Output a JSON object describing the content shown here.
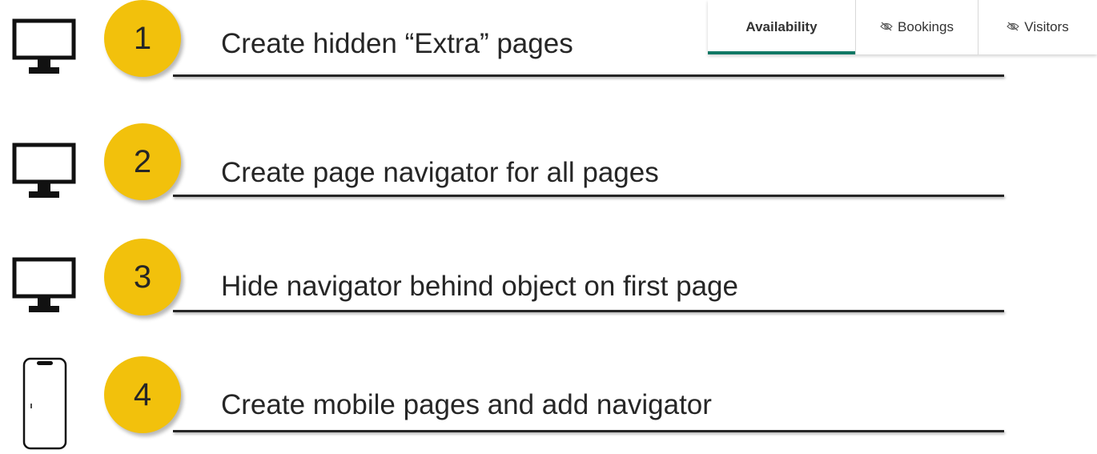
{
  "steps": [
    {
      "number": "1",
      "text": "Create hidden “Extra” pages",
      "device_icon": "monitor-icon"
    },
    {
      "number": "2",
      "text": "Create page navigator for all pages",
      "device_icon": "monitor-icon"
    },
    {
      "number": "3",
      "text": "Hide navigator behind object on first page",
      "device_icon": "monitor-icon"
    },
    {
      "number": "4",
      "text": "Create mobile pages and add navigator",
      "device_icon": "phone-icon"
    }
  ],
  "tabs": [
    {
      "label": "Availability",
      "active": true,
      "hidden": false
    },
    {
      "label": "Bookings",
      "active": false,
      "hidden": true
    },
    {
      "label": "Visitors",
      "active": false,
      "hidden": true
    }
  ],
  "colors": {
    "badge": "#f2c10c",
    "text": "#262626",
    "active_tab_indicator": "#117865"
  }
}
